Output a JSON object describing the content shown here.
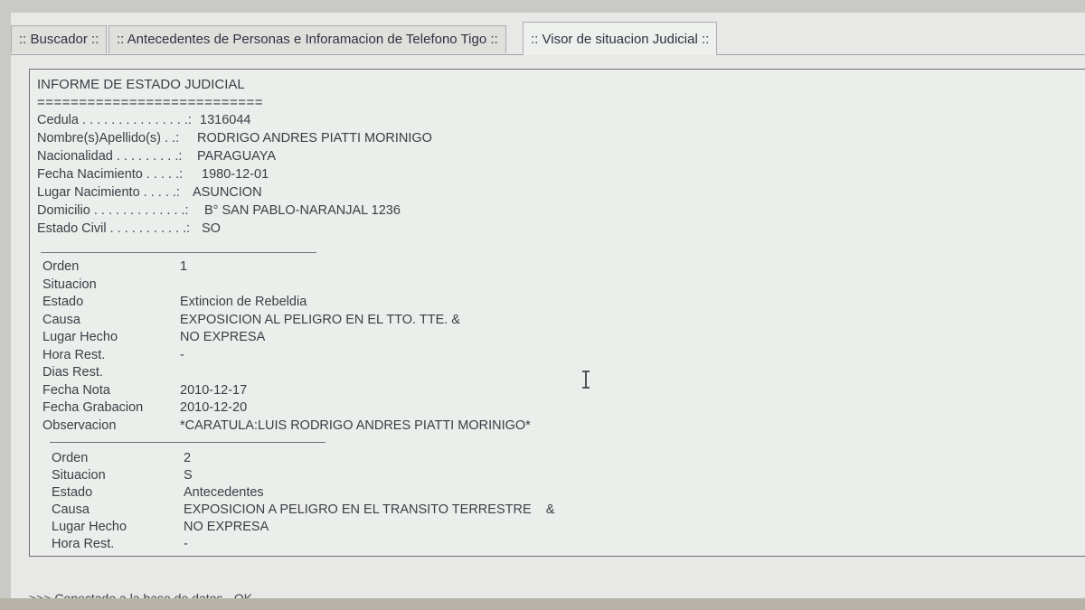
{
  "tabs": [
    {
      "label": ":: Buscador ::"
    },
    {
      "label": ":: Antecedentes de Personas e Inforamacion de Telefono Tigo ::"
    },
    {
      "label": ":: Visor de situacion Judicial ::"
    }
  ],
  "report": {
    "title": "INFORME DE ESTADO JUDICIAL",
    "rule": "===========================",
    "person": [
      {
        "label": "Cedula . . . . . . . . . . . . . . .:",
        "value": "1316044"
      },
      {
        "label": "Nombre(s)Apellido(s) . .:",
        "value": "RODRIGO ANDRES PIATTI MORINIGO"
      },
      {
        "label": "Nacionalidad . . . . . . . . .:",
        "value": "PARAGUAYA"
      },
      {
        "label": "Fecha Nacimiento . . . . .:",
        "value": "1980-12-01"
      },
      {
        "label": "Lugar Nacimiento . . . . .:",
        "value": "ASUNCION"
      },
      {
        "label": "Domicilio . . . . . . . . . . . . .:",
        "value": "B° SAN PABLO-NARANJAL 1236"
      },
      {
        "label": "Estado Civil . . . . . . . . . . .:",
        "value": "SO"
      }
    ],
    "records": [
      {
        "fields": [
          {
            "label": "Orden",
            "value": "1"
          },
          {
            "label": "Situacion",
            "value": ""
          },
          {
            "label": "Estado",
            "value": "Extincion de Rebeldia"
          },
          {
            "label": "Causa",
            "value": "EXPOSICION AL PELIGRO EN EL TTO. TTE. &"
          },
          {
            "label": "Lugar Hecho",
            "value": "NO EXPRESA"
          },
          {
            "label": "Hora Rest.",
            "value": "-"
          },
          {
            "label": "Dias Rest.",
            "value": ""
          },
          {
            "label": "Fecha Nota",
            "value": "2010-12-17"
          },
          {
            "label": "Fecha Grabacion",
            "value": "2010-12-20"
          },
          {
            "label": "Observacion",
            "value": "*CARATULA:LUIS RODRIGO ANDRES PIATTI MORINIGO*"
          }
        ]
      },
      {
        "fields": [
          {
            "label": "Orden",
            "value": "2"
          },
          {
            "label": "Situacion",
            "value": "S"
          },
          {
            "label": "Estado",
            "value": "Antecedentes"
          },
          {
            "label": "Causa",
            "value": "EXPOSICION A PELIGRO EN EL TRANSITO TERRESTRE    &"
          },
          {
            "label": "Lugar Hecho",
            "value": "NO EXPRESA"
          },
          {
            "label": "Hora Rest.",
            "value": "-"
          }
        ]
      }
    ]
  },
  "status": ">>> Conectado a la base de datos - OK."
}
